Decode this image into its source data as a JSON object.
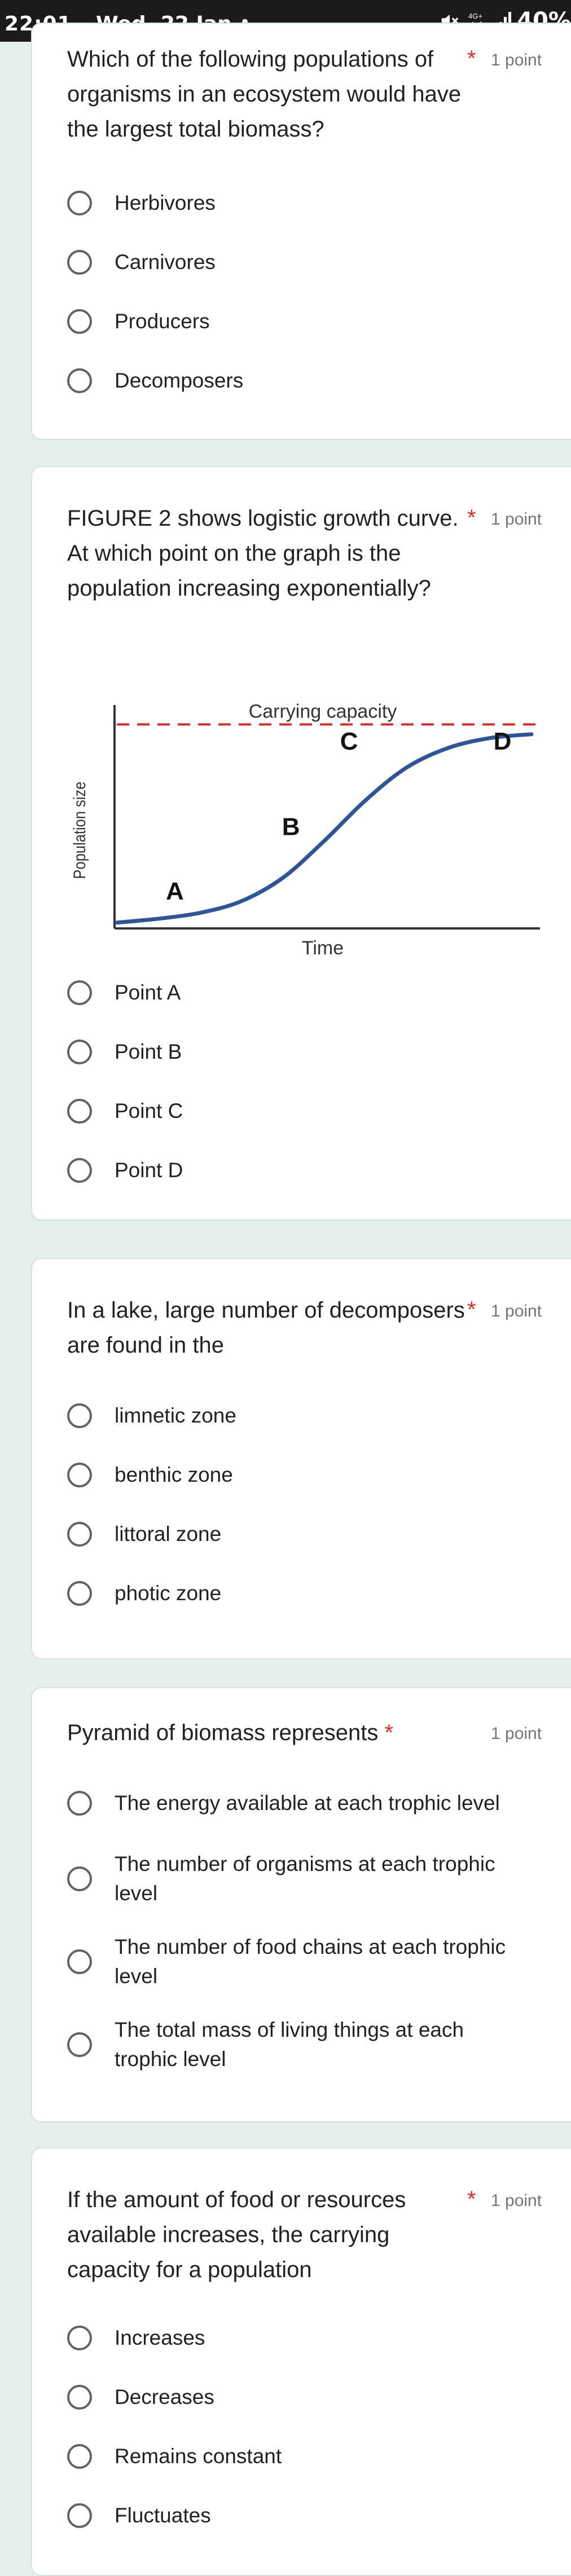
{
  "status_bar": {
    "time": "22:01",
    "date": "Wed, 22 Jan",
    "dot": "•",
    "network": "4G+",
    "battery": "40%"
  },
  "questions": [
    {
      "text": "Which of the following populations of organisms in an ecosystem would have the largest total biomass?",
      "required": "*",
      "points": "1 point",
      "options": [
        "Herbivores",
        "Carnivores",
        "Producers",
        "Decomposers"
      ]
    },
    {
      "text": "FIGURE 2 shows logistic growth curve. At which point on the graph is the population increasing exponentially?",
      "required": "*",
      "points": "1 point",
      "options": [
        "Point A",
        "Point B",
        "Point C",
        "Point D"
      ]
    },
    {
      "text": "In a lake, large number of decomposers are found in the",
      "required": "*",
      "points": "1 point",
      "options": [
        "limnetic zone",
        "benthic zone",
        "littoral zone",
        "photic zone"
      ]
    },
    {
      "text": "Pyramid of biomass represents",
      "required": "*",
      "points": "1 point",
      "options": [
        "The energy available at each trophic level",
        "The number of organisms at each trophic level",
        "The number of food chains at each trophic level",
        "The total mass of living things at each trophic level"
      ]
    },
    {
      "text": "If the amount of food or resources available increases, the carrying capacity for a population",
      "required": "*",
      "points": "1 point",
      "options": [
        "Increases",
        "Decreases",
        "Remains constant",
        "Fluctuates"
      ]
    }
  ],
  "chart_data": {
    "type": "line",
    "title": "",
    "xlabel": "Time",
    "ylabel": "Population size",
    "series": [
      {
        "x": [
          0,
          1,
          2,
          3,
          4,
          5,
          6,
          7,
          8,
          9,
          10
        ],
        "y": [
          0.03,
          0.05,
          0.08,
          0.14,
          0.26,
          0.45,
          0.66,
          0.83,
          0.93,
          0.98,
          1.0
        ]
      }
    ],
    "reference_lines": [
      {
        "label": "Carrying capacity",
        "y": 1.05,
        "style": "dashed",
        "color": "#d32f2f"
      }
    ],
    "annotations": [
      {
        "label": "A",
        "x": 1.4,
        "y": 0.15
      },
      {
        "label": "B",
        "x": 4.2,
        "y": 0.48
      },
      {
        "label": "C",
        "x": 5.6,
        "y": 0.92
      },
      {
        "label": "D",
        "x": 9.3,
        "y": 0.92
      }
    ],
    "xlim": [
      0,
      10
    ],
    "ylim": [
      0,
      1.15
    ],
    "line_color": "#2f5597",
    "grid": false,
    "legend": "none"
  }
}
